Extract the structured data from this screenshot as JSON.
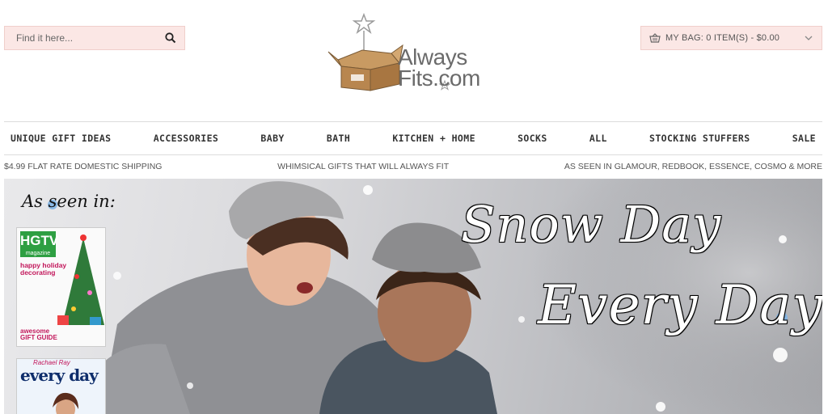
{
  "search": {
    "placeholder": "Find it here..."
  },
  "logo": {
    "text_line1": "Always",
    "text_line2": "Fits.com"
  },
  "cart": {
    "label": "MY BAG: 0 ITEM(S) - $0.00"
  },
  "nav": {
    "items": [
      "UNIQUE GIFT IDEAS",
      "ACCESSORIES",
      "BABY",
      "BATH",
      "KITCHEN + HOME",
      "SOCKS",
      "ALL",
      "STOCKING STUFFERS",
      "SALE"
    ]
  },
  "promo": {
    "left": "$4.99 FLAT RATE DOMESTIC SHIPPING",
    "center": "WHIMSICAL GIFTS THAT WILL ALWAYS FIT",
    "right": "AS SEEN IN GLAMOUR, REDBOOK, ESSENCE, COSMO & MORE"
  },
  "hero": {
    "as_seen_in": "As seen in:",
    "headline_line1": "Snow Day",
    "headline_line2": "Every Day!",
    "magazine1": {
      "brand": "HGTV",
      "sub": "magazine",
      "headline": "happy holiday decorating",
      "guide": "awesome GIFT GUIDE"
    },
    "magazine2": {
      "top": "Rachael Ray",
      "brand": "every day"
    }
  },
  "colors": {
    "accent_bg": "#fbe7e5",
    "nav_text": "#333333",
    "hgtv_green": "#2e9f42"
  }
}
